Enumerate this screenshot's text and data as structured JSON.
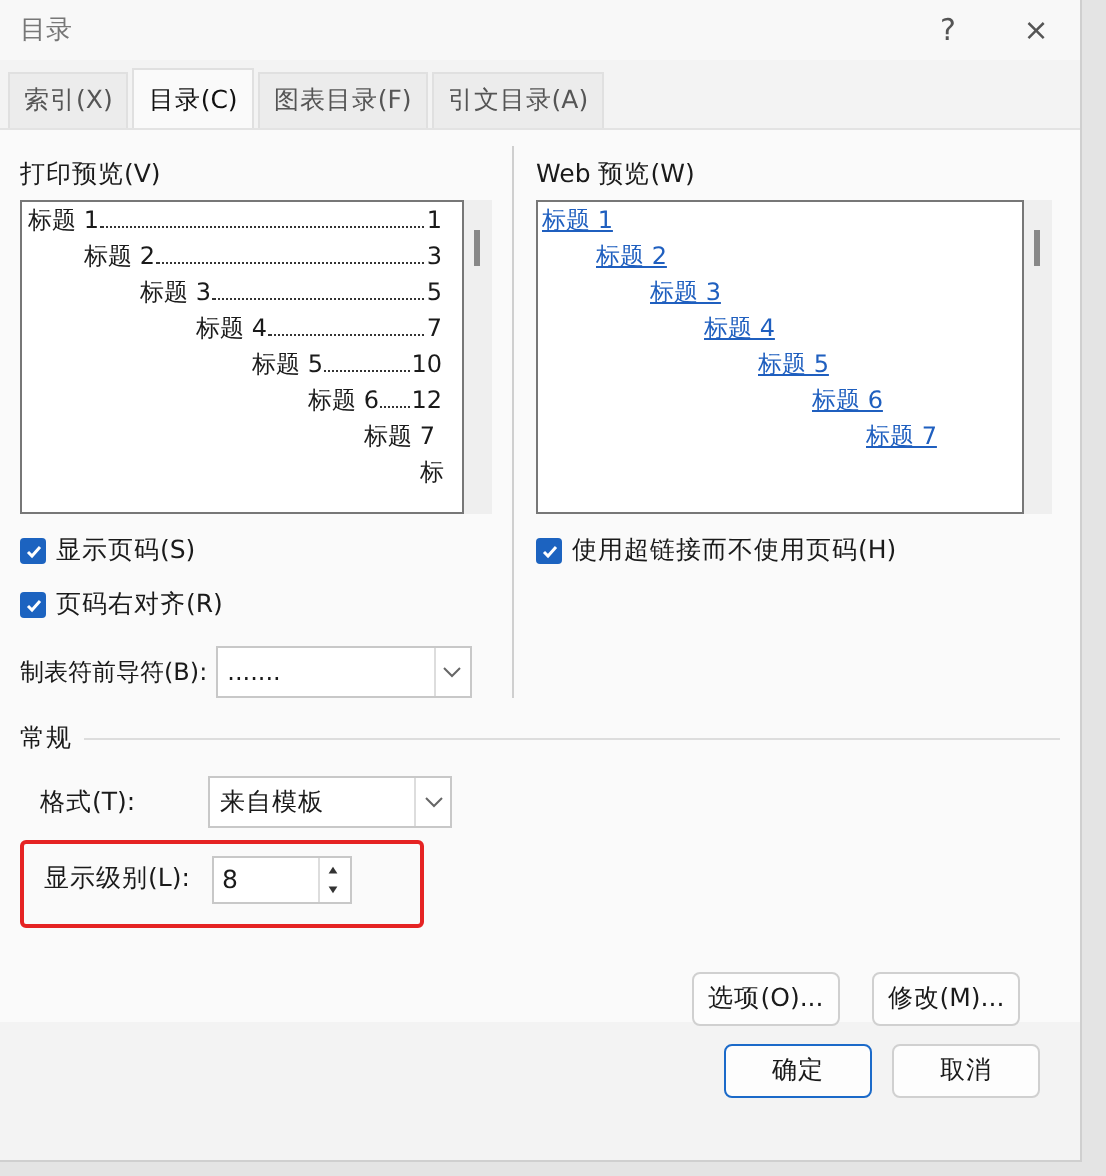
{
  "window": {
    "title": "目录",
    "help": "?",
    "close": "×"
  },
  "tabs": [
    {
      "label": "索引(X)",
      "selected": false
    },
    {
      "label": "目录(C)",
      "selected": true
    },
    {
      "label": "图表目录(F)",
      "selected": false
    },
    {
      "label": "引文目录(A)",
      "selected": false
    }
  ],
  "print_preview": {
    "label": "打印预览(V)",
    "entries": [
      {
        "text": "标题 1",
        "page": "1"
      },
      {
        "text": "标题 2",
        "page": "3"
      },
      {
        "text": "标题 3",
        "page": "5"
      },
      {
        "text": "标题 4",
        "page": "7"
      },
      {
        "text": "标题 5",
        "page": "10"
      },
      {
        "text": "标题 6",
        "page": "12"
      },
      {
        "text": "标题 7"
      },
      {
        "text": "标"
      }
    ]
  },
  "web_preview": {
    "label": "Web 预览(W)",
    "entries": [
      "标题 1",
      "标题 2",
      "标题 3",
      "标题 4",
      "标题 5",
      "标题 6",
      "标题 7"
    ]
  },
  "left_options": [
    {
      "label": "显示页码(S)",
      "checked": true
    },
    {
      "label": "页码右对齐(R)",
      "checked": true
    }
  ],
  "leader": {
    "label": "制表符前导符(B):",
    "value": "......."
  },
  "web_option": {
    "label": "使用超链接而不使用页码(H)",
    "checked": true
  },
  "general": {
    "title": "常规",
    "format_label": "格式(T):",
    "format_value": "来自模板",
    "levels_label": "显示级别(L):",
    "levels_value": "8",
    "highlighted": true
  },
  "buttons": {
    "options": "选项(O)...",
    "modify": "修改(M)...",
    "ok": "确定",
    "cancel": "取消"
  }
}
